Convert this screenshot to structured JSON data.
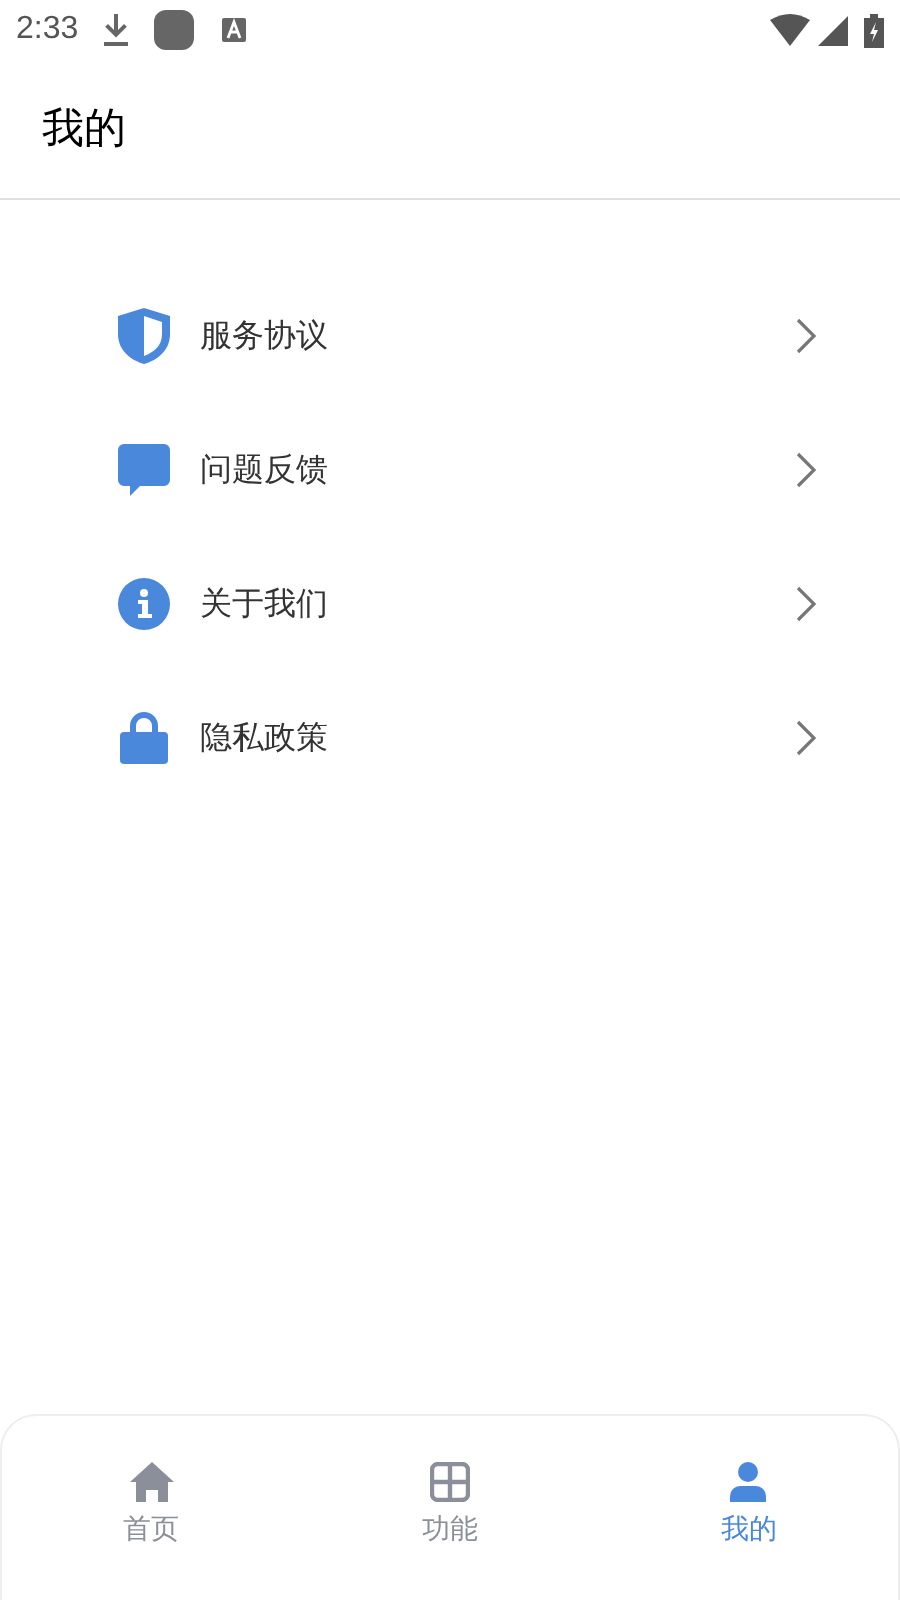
{
  "status_bar": {
    "time": "2:33"
  },
  "header": {
    "title": "我的"
  },
  "menu": [
    {
      "kind": "shield",
      "label": "服务协议"
    },
    {
      "kind": "chat",
      "label": "问题反馈"
    },
    {
      "kind": "info",
      "label": "关于我们"
    },
    {
      "kind": "lock",
      "label": "隐私政策"
    }
  ],
  "tabs": [
    {
      "kind": "home",
      "label": "首页",
      "selected": false
    },
    {
      "kind": "grid",
      "label": "功能",
      "selected": false
    },
    {
      "kind": "person",
      "label": "我的",
      "selected": true
    }
  ]
}
